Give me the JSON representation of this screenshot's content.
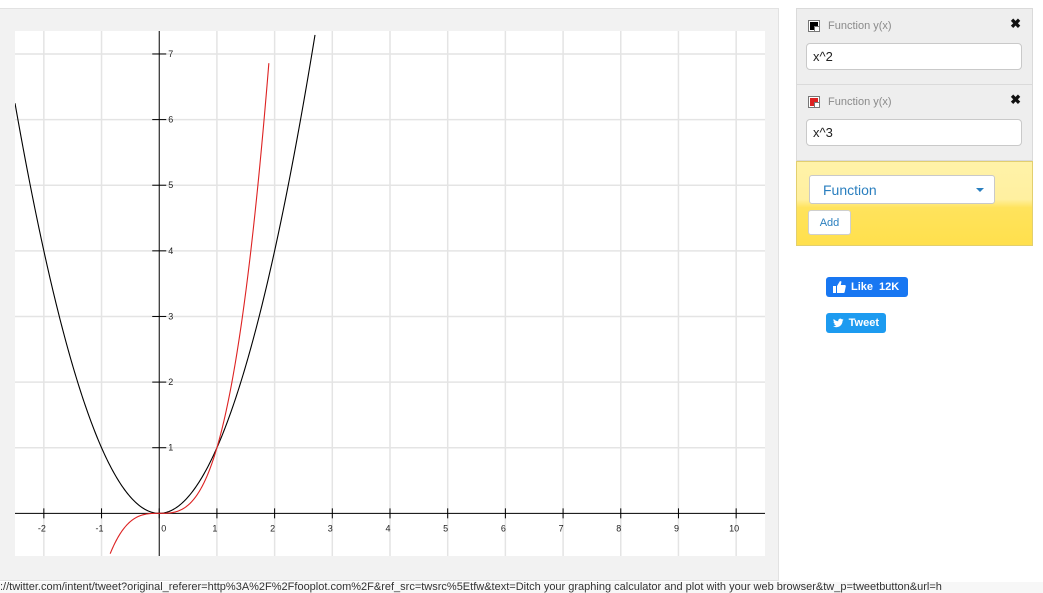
{
  "functions": [
    {
      "title": "Function y(x)",
      "expression": "x^2",
      "color": "#000000"
    },
    {
      "title": "Function y(x)",
      "expression": "x^3",
      "color": "#dd2222"
    }
  ],
  "add_panel": {
    "type_label": "Function",
    "add_label": "Add"
  },
  "social": {
    "like_label": "Like",
    "like_count": "12K",
    "tweet_label": "Tweet"
  },
  "status_bar": {
    "url": "://twitter.com/intent/tweet?original_referer=http%3A%2F%2Ffooplot.com%2F&ref_src=twsrc%5Etfw&text=Ditch your graphing calculator and plot with your web browser&tw_p=tweetbutton&url=h"
  },
  "chart_data": {
    "type": "line",
    "x_range": [
      -2.5,
      10.5
    ],
    "y_range": [
      -0.65,
      7.35
    ],
    "x_ticks": [
      -2,
      -1,
      0,
      1,
      2,
      3,
      4,
      5,
      6,
      7,
      8,
      9,
      10
    ],
    "y_ticks": [
      0,
      1,
      2,
      3,
      4,
      5,
      6,
      7
    ],
    "grid": true,
    "series": [
      {
        "expression": "x^2",
        "color": "#000000",
        "x": [
          -2.5,
          -2,
          -1.5,
          -1,
          -0.5,
          0,
          0.5,
          1,
          1.5,
          2,
          2.5,
          2.7
        ],
        "y": [
          6.25,
          4,
          2.25,
          1,
          0.25,
          0,
          0.25,
          1,
          2.25,
          4,
          6.25,
          7.29
        ]
      },
      {
        "expression": "x^3",
        "color": "#dd2222",
        "x": [
          -0.85,
          -0.5,
          0,
          0.5,
          1,
          1.5,
          1.9
        ],
        "y": [
          -0.61,
          -0.125,
          0,
          0.125,
          1,
          3.375,
          6.859
        ]
      }
    ]
  }
}
